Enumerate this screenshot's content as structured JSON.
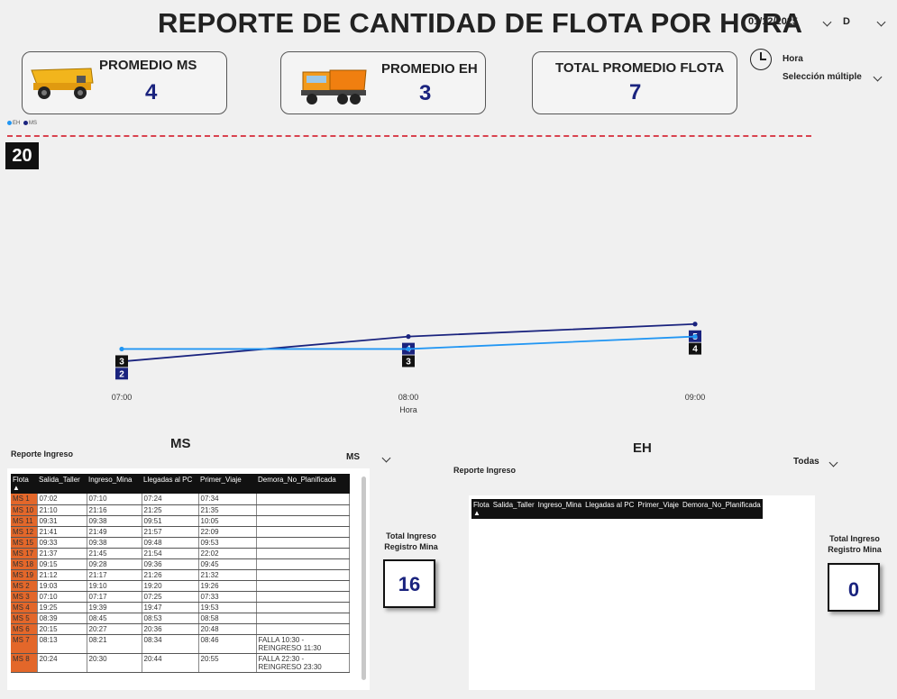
{
  "title": "REPORTE DE CANTIDAD DE FLOTA POR HORA",
  "date_slicer": "01/12/2025",
  "d_slicer": "D",
  "kpis": [
    {
      "title": "PROMEDIO MS",
      "value": "4"
    },
    {
      "title": "PROMEDIO EH",
      "value": "3"
    },
    {
      "title": "TOTAL PROMEDIO FLOTA",
      "value": "7"
    }
  ],
  "hora_filter": {
    "label": "Hora",
    "value": "Selección múltiple"
  },
  "legend": [
    "EH",
    "MS"
  ],
  "reference_value": "20",
  "chart_data": {
    "type": "line",
    "x": [
      "07:00",
      "08:00",
      "09:00"
    ],
    "xlabel": "Hora",
    "series": [
      {
        "name": "MS",
        "values": [
          2,
          4,
          5
        ],
        "color": "#1a237e"
      },
      {
        "name": "EH",
        "values": [
          3,
          3,
          4
        ],
        "color": "#2196f3"
      }
    ]
  },
  "ms_section": {
    "title": "MS",
    "report_label": "Reporte Ingreso",
    "filter": "MS",
    "columns": [
      "Flota",
      "Salida_Taller",
      "Ingreso_Mina",
      "Llegadas al PC",
      "Primer_Viaje",
      "Demora_No_Planificada"
    ],
    "rows": [
      [
        "MS 1",
        "07:02",
        "07:10",
        "07:24",
        "07:34",
        ""
      ],
      [
        "MS 10",
        "21:10",
        "21:16",
        "21:25",
        "21:35",
        ""
      ],
      [
        "MS 11",
        "09:31",
        "09:38",
        "09:51",
        "10:05",
        ""
      ],
      [
        "MS 12",
        "21:41",
        "21:49",
        "21:57",
        "22:09",
        ""
      ],
      [
        "MS 15",
        "09:33",
        "09:38",
        "09:48",
        "09:53",
        ""
      ],
      [
        "MS 17",
        "21:37",
        "21:45",
        "21:54",
        "22:02",
        ""
      ],
      [
        "MS 18",
        "09:15",
        "09:28",
        "09:36",
        "09:45",
        ""
      ],
      [
        "MS 19",
        "21:12",
        "21:17",
        "21:26",
        "21:32",
        ""
      ],
      [
        "MS 2",
        "19:03",
        "19:10",
        "19:20",
        "19:26",
        ""
      ],
      [
        "MS 3",
        "07:10",
        "07:17",
        "07:25",
        "07:33",
        ""
      ],
      [
        "MS 4",
        "19:25",
        "19:39",
        "19:47",
        "19:53",
        ""
      ],
      [
        "MS 5",
        "08:39",
        "08:45",
        "08:53",
        "08:58",
        ""
      ],
      [
        "MS 6",
        "20:15",
        "20:27",
        "20:36",
        "20:48",
        ""
      ],
      [
        "MS 7",
        "08:13",
        "08:21",
        "08:34",
        "08:46",
        "FALLA 10:30 - REINGRESO 11:30"
      ],
      [
        "MS 8",
        "20:24",
        "20:30",
        "20:44",
        "20:55",
        "FALLA 22:30 - REINGRESO 23:30"
      ]
    ],
    "total_label": "Total Ingreso Registro Mina",
    "total_value": "16"
  },
  "eh_section": {
    "title": "EH",
    "report_label": "Reporte Ingreso",
    "filter": "Todas",
    "columns": [
      "Flota",
      "Salida_Taller",
      "Ingreso_Mina",
      "Llegadas al PC",
      "Primer_Viaje",
      "Demora_No_Planificada"
    ],
    "total_label": "Total Ingreso Registro Mina",
    "total_value": "0"
  }
}
